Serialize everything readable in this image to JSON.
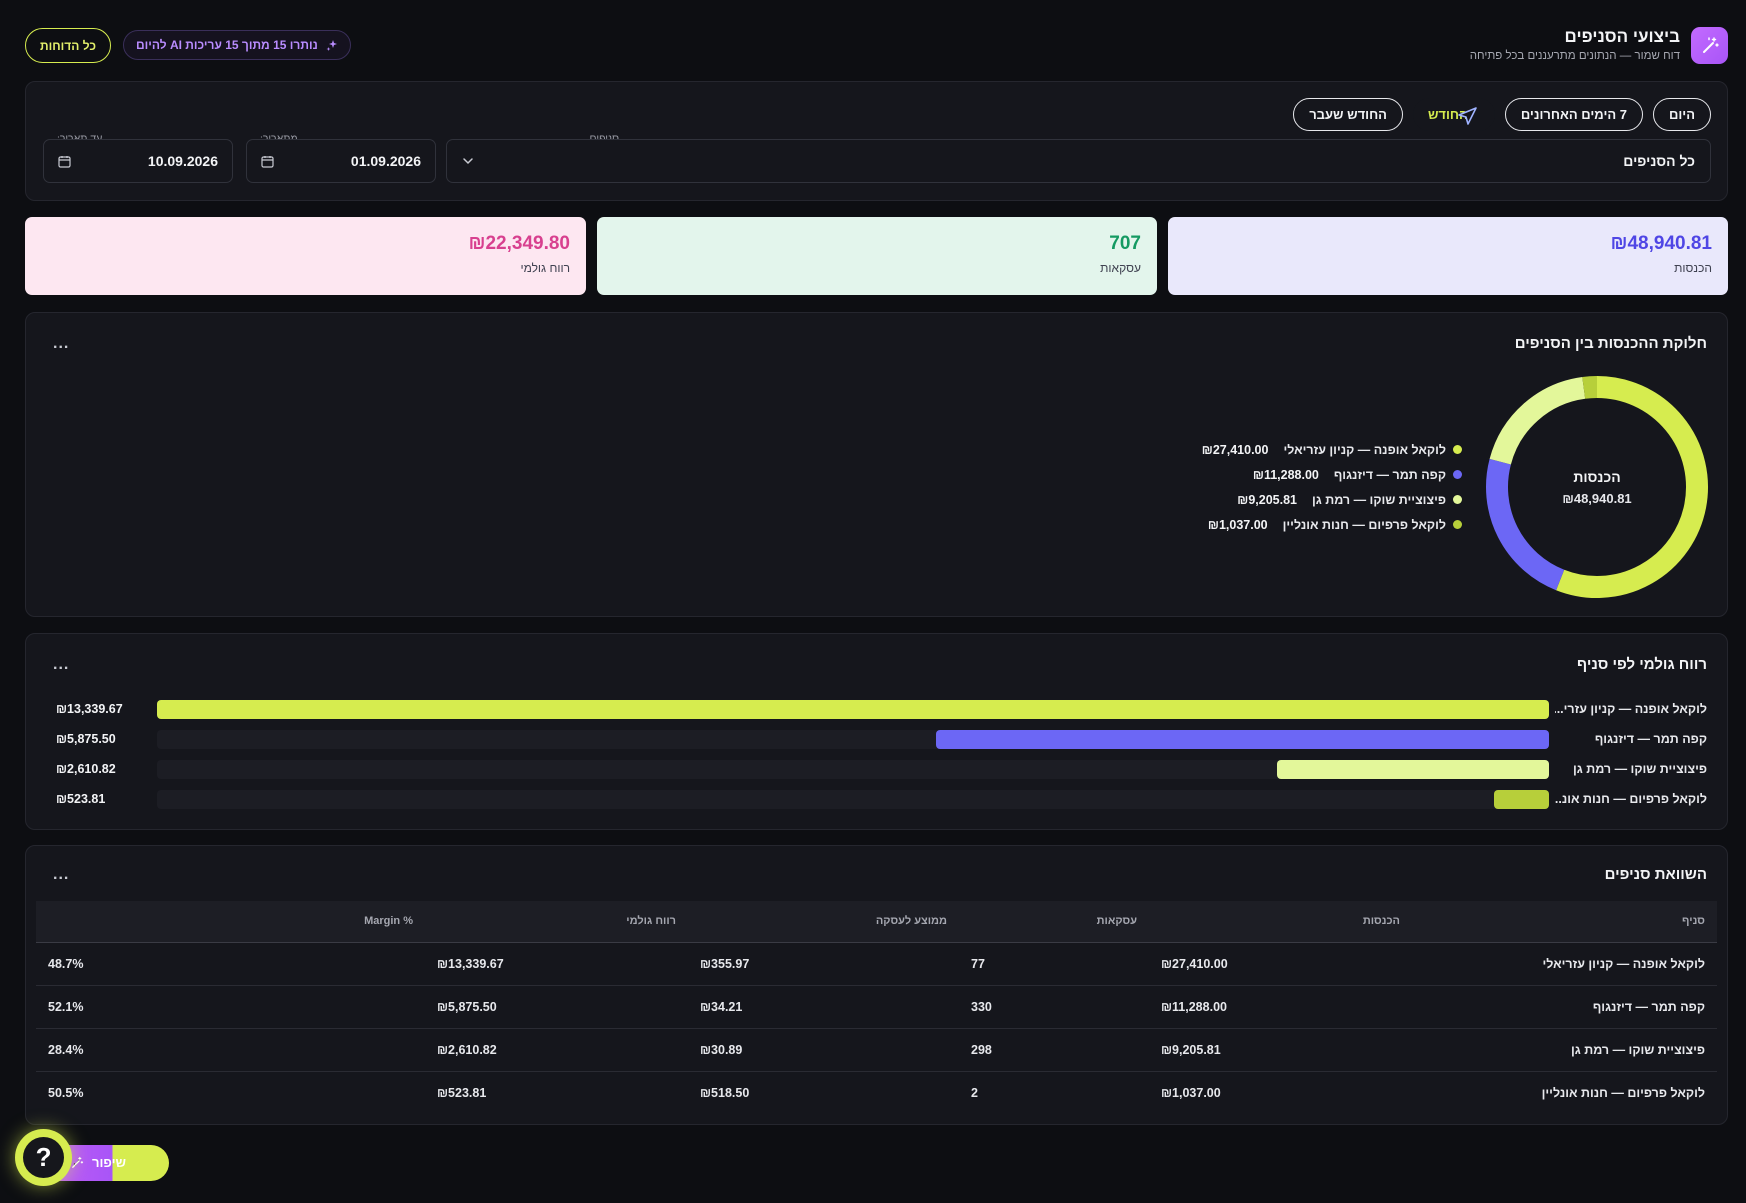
{
  "header": {
    "title": "ביצועי הסניפים",
    "subtitle": "דוח שמור — הנתונים מתרעננים בכל פתיחה",
    "ai_pill": "נותרו 15 מתוך 15 עריכות AI להיום",
    "all_reports": "כל הדוחות"
  },
  "filters": {
    "ranges": [
      "היום",
      "7 הימים האחרונים",
      "החודש",
      "החודש שעבר"
    ],
    "active_range": "החודש",
    "branches_label": "סניפים",
    "branches_value": "כל הסניפים",
    "from_label": "מתאריך:",
    "from_value": "01.09.2026",
    "to_label": "עד תאריך:",
    "to_value": "10.09.2026"
  },
  "kpis": {
    "revenue": {
      "value": "₪48,940.81",
      "label": "הכנסות"
    },
    "transactions": {
      "value": "707",
      "label": "עסקאות"
    },
    "gross_profit": {
      "value": "₪22,349.80",
      "label": "רווח גולמי"
    }
  },
  "donut": {
    "title": "חלוקת ההכנסות בין הסניפים",
    "more": "...",
    "center_label": "הכנסות",
    "center_value": "₪48,940.81"
  },
  "bars": {
    "title": "רווח גולמי לפי סניף",
    "more": "..."
  },
  "table": {
    "title": "השוואת סניפים",
    "more": "...",
    "headers": [
      "סניף",
      "הכנסות",
      "עסקאות",
      "ממוצע לעסקה",
      "רווח גולמי",
      "% Margin"
    ],
    "rows": [
      [
        "לוקאל אופנה — קניון עזריאלי",
        "₪27,410.00",
        "77",
        "₪355.97",
        "₪13,339.67",
        "48.7%"
      ],
      [
        "קפה תמר — דיזנגוף",
        "₪11,288.00",
        "330",
        "₪34.21",
        "₪5,875.50",
        "52.1%"
      ],
      [
        "פיצוציית שוקו — רמת גן",
        "₪9,205.81",
        "298",
        "₪30.89",
        "₪2,610.82",
        "28.4%"
      ],
      [
        "לוקאל פרפיום — חנות אונליין",
        "₪1,037.00",
        "2",
        "₪518.50",
        "₪523.81",
        "50.5%"
      ]
    ]
  },
  "float": {
    "pill_label": "שיפור",
    "help": "?"
  },
  "chart_data": [
    {
      "type": "pie",
      "title": "חלוקת ההכנסות בין הסניפים",
      "categories": [
        "לוקאל אופנה — קניון עזריאלי",
        "קפה תמר — דיזנגוף",
        "פיצוציית שוקו — רמת גן",
        "לוקאל פרפיום — חנות אונליין"
      ],
      "values": [
        27410.0,
        11288.0,
        9205.81,
        1037.0
      ],
      "value_labels": [
        "₪27,410.00",
        "₪11,288.00",
        "₪9,205.81",
        "₪1,037.00"
      ],
      "colors": [
        "#d6ec4f",
        "#6c67f5",
        "#e3f79a",
        "#b7cf3a"
      ],
      "legend": "left"
    },
    {
      "type": "bar",
      "orientation": "horizontal",
      "title": "רווח גולמי לפי סניף",
      "categories": [
        "לוקאל אופנה — קניון עזרי...",
        "קפה תמר — דיזנגוף",
        "פיצוציית שוקו — רמת גן",
        "לוקאל פרפיום — חנות אונ..."
      ],
      "values": [
        13339.67,
        5875.5,
        2610.82,
        523.81
      ],
      "value_labels": [
        "₪13,339.67",
        "₪5,875.50",
        "₪2,610.82",
        "₪523.81"
      ],
      "colors": [
        "#d6ec4f",
        "#6c67f5",
        "#e3f79a",
        "#b7cf3a"
      ]
    }
  ]
}
